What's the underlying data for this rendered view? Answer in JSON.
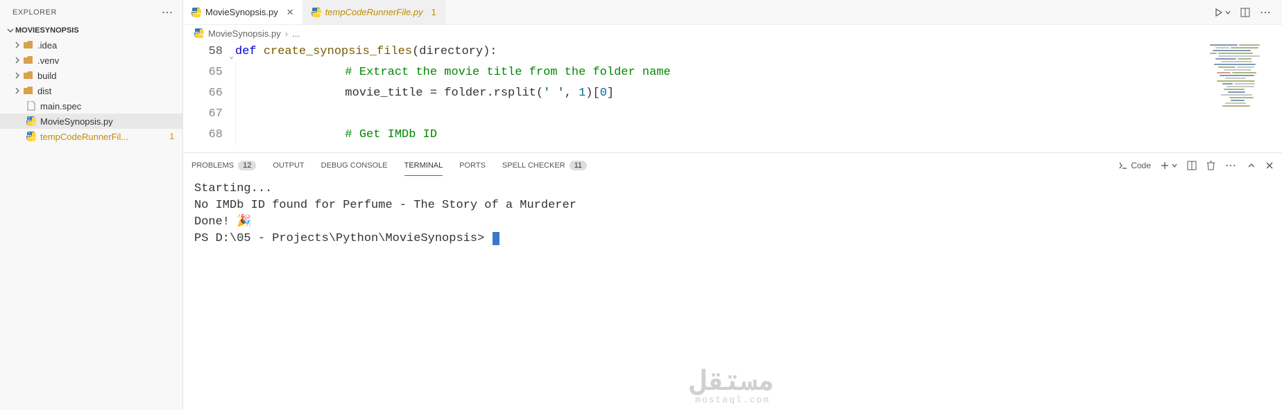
{
  "sidebar": {
    "title": "EXPLORER",
    "project": "MOVIESYNOPSIS",
    "items": [
      {
        "label": ".idea",
        "type": "folder"
      },
      {
        "label": ".venv",
        "type": "folder"
      },
      {
        "label": "build",
        "type": "folder"
      },
      {
        "label": "dist",
        "type": "folder"
      },
      {
        "label": "main.spec",
        "type": "file",
        "icon": "file"
      },
      {
        "label": "MovieSynopsis.py",
        "type": "file",
        "icon": "python",
        "active": true
      },
      {
        "label": "tempCodeRunnerFil...",
        "type": "file",
        "icon": "python",
        "modified": true,
        "badge": "1"
      }
    ]
  },
  "tabs": {
    "items": [
      {
        "label": "MovieSynopsis.py",
        "active": true,
        "modified": false
      },
      {
        "label": "tempCodeRunnerFile.py",
        "active": false,
        "modified": true,
        "dirty": "1"
      }
    ]
  },
  "breadcrumb": {
    "file": "MovieSynopsis.py",
    "sep": "›",
    "symbol": "..."
  },
  "editor": {
    "lines": [
      {
        "num": "58",
        "sticky": true,
        "html": "<span class='kw'>def</span> <span class='fn'>create_synopsis_files</span>(directory):"
      },
      {
        "num": "65",
        "html": "            <span class='cm'># Extract the movie title from the folder name</span>"
      },
      {
        "num": "66",
        "html": "            movie_title = folder.rsplit(<span class='str'>' '</span>, <span class='num'>1</span>)[<span class='num'>0</span>]"
      },
      {
        "num": "67",
        "html": ""
      },
      {
        "num": "68",
        "html": "            <span class='cm'># Get IMDb ID</span>"
      }
    ]
  },
  "panel": {
    "tabs": {
      "problems": {
        "label": "PROBLEMS",
        "count": "12"
      },
      "output": {
        "label": "OUTPUT"
      },
      "debug": {
        "label": "DEBUG CONSOLE"
      },
      "terminal": {
        "label": "TERMINAL"
      },
      "ports": {
        "label": "PORTS"
      },
      "spell": {
        "label": "SPELL CHECKER",
        "count": "11"
      }
    },
    "launch_label": "Code",
    "terminal_lines": [
      "Starting...",
      "No IMDb ID found for Perfume - The Story of a Murderer",
      "Done! 🎉",
      "PS D:\\05 - Projects\\Python\\MovieSynopsis> "
    ]
  },
  "watermark": {
    "main": "مستقل",
    "sub": "mostaql.com"
  }
}
